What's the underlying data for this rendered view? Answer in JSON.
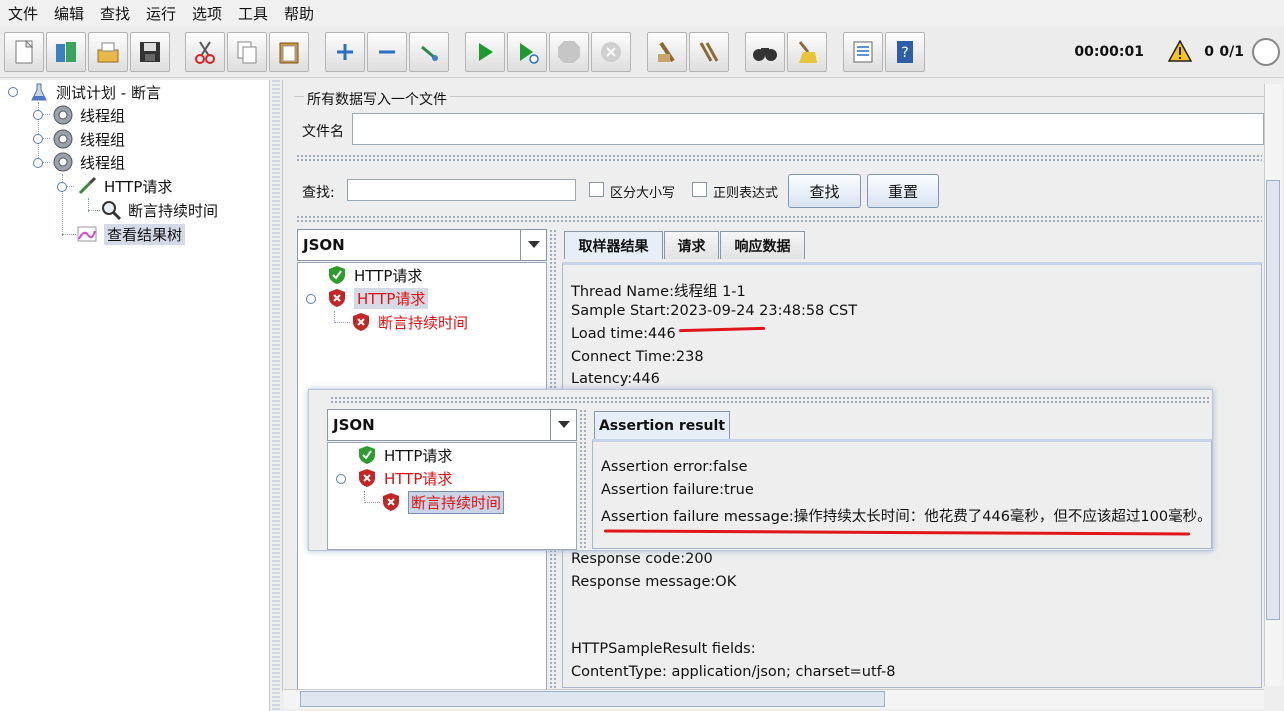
{
  "menu": [
    "文件",
    "编辑",
    "查找",
    "运行",
    "选项",
    "工具",
    "帮助"
  ],
  "toolbar": {
    "timer": "00:00:01",
    "error_count": "0",
    "threads": "0/1",
    "buttons": [
      "new-icon",
      "templates-icon",
      "open-icon",
      "save-icon",
      "cut-icon",
      "copy-icon",
      "paste-icon",
      "expand-icon",
      "collapse-icon",
      "toggle-icon",
      "start-icon",
      "start-no-pause-icon",
      "stop-icon",
      "shutdown-icon",
      "clear-icon",
      "clear-all-icon",
      "search-icon",
      "reset-search-icon",
      "function-helper-icon",
      "help-icon"
    ]
  },
  "tree": {
    "root": "测试计划 - 断言",
    "thread_group_1": "线程组",
    "thread_group_2": "线程组",
    "thread_group_3": "线程组",
    "http_request": "HTTP请求",
    "duration_assertion": "断言持续时间",
    "results_tree": "查看结果树"
  },
  "file_panel": {
    "legend": "所有数据写入一个文件",
    "filename_label": "文件名",
    "filename_value": ""
  },
  "search_bar": {
    "label": "查找:",
    "value": "",
    "case_sensitive": "区分大小写",
    "regex": "正则表达式",
    "search_button": "查找",
    "reset_button": "重置"
  },
  "renderer": {
    "selected": "JSON"
  },
  "results_list": {
    "item1": "HTTP请求",
    "item2": "HTTP请求",
    "item3": "断言持续时间"
  },
  "tabs": {
    "sampler_result": "取样器结果",
    "request": "请求",
    "response_data": "响应数据"
  },
  "sampler_result": {
    "thread_name": "Thread Name:线程组 1-1",
    "sample_start": "Sample Start:2023-09-24 23:48:58 CST",
    "load_time": "Load time:446",
    "connect_time": "Connect Time:238",
    "latency": "Latency:446",
    "response_code": "Response code:200",
    "response_message": "Response message:OK",
    "fields_header": "HTTPSampleResult fields:",
    "content_type": "ContentType: application/json; charset=utf-8"
  },
  "overlay": {
    "renderer": "JSON",
    "item1": "HTTP请求",
    "item2": "HTTP请求",
    "item3": "断言持续时间",
    "tab": "Assertion result",
    "assertion_error": "Assertion error:false",
    "assertion_failure": "Assertion failure:true",
    "assertion_message": "Assertion failure message:操作持续太长时间：他花费了446毫秒，但不应该超过100毫秒。"
  },
  "colors": {
    "fail_red": "#e01010",
    "underline_red": "#e0161c",
    "pass_green": "#2e9b2e",
    "selection": "#d5dbe6"
  }
}
